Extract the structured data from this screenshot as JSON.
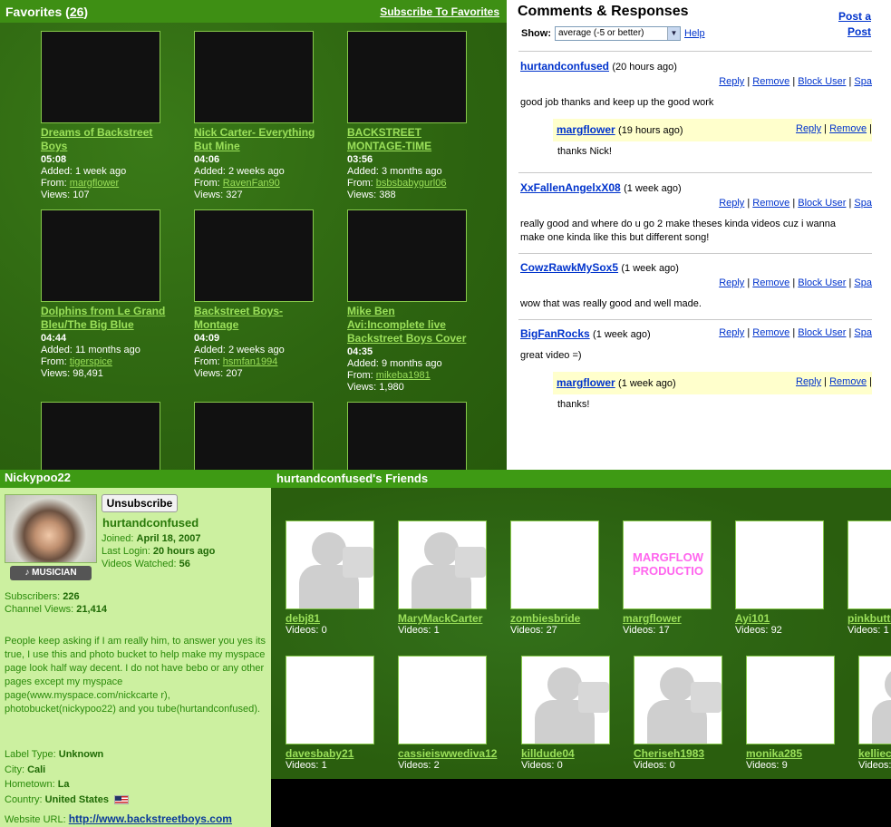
{
  "favorites": {
    "title": "Favorites",
    "count": "26",
    "subscribe_link": "Subscribe To Favorites",
    "added_label": "Added:",
    "from_label": "From:",
    "views_label": "Views:",
    "videos": [
      {
        "title": "Dreams of Backstreet Boys",
        "duration": "05:08",
        "added": "1 week ago",
        "from": "margflower",
        "views": "107"
      },
      {
        "title": "Nick Carter- Everything But Mine",
        "duration": "04:06",
        "added": "2 weeks ago",
        "from": "RavenFan90",
        "views": "327"
      },
      {
        "title": "BACKSTREET MONTAGE-TIME",
        "duration": "03:56",
        "added": "3 months ago",
        "from": "bsbsbabygurl06",
        "views": "388"
      },
      {
        "title": "Dolphins from Le Grand Bleu/The Big Blue",
        "duration": "04:44",
        "added": "11 months ago",
        "from": "tigerspice",
        "views": "98,491"
      },
      {
        "title": "Backstreet Boys-Montage",
        "duration": "04:09",
        "added": "2 weeks ago",
        "from": "hsmfan1994",
        "views": "207"
      },
      {
        "title": "Mike Ben Avi:Incomplete live Backstreet Boys Cover",
        "duration": "04:35",
        "added": "9 months ago",
        "from": "mikeba1981",
        "views": "1,980"
      }
    ]
  },
  "comments": {
    "title": "Comments & Responses",
    "post_link_line1": "Post a",
    "post_link_line2": "Post",
    "show_label": "Show:",
    "filter_value": "average (-5 or better)",
    "help_link": "Help",
    "actions": {
      "reply": "Reply",
      "remove": "Remove",
      "block": "Block User",
      "spam": "Spa"
    },
    "items": [
      {
        "user": "hurtandconfused",
        "time": "(20 hours ago)",
        "text": "good job thanks and keep up the good work",
        "reply": {
          "user": "margflower",
          "time": "(19 hours ago)",
          "text": "thanks Nick!"
        }
      },
      {
        "user": "XxFallenAngelxX08",
        "time": "(1 week ago)",
        "text": "really good and where do u go 2 make theses kinda videos cuz i wanna make one kinda like this but different song!"
      },
      {
        "user": "CowzRawkMySox5",
        "time": "(1 week ago)",
        "text": "wow that was really good and well made."
      },
      {
        "user": "BigFanRocks",
        "time": "(1 week ago)",
        "text": "great video =)",
        "reply": {
          "user": "margflower",
          "time": "(1 week ago)",
          "text": "thanks!"
        }
      }
    ]
  },
  "profile": {
    "header": "Nickypoo22",
    "badge": "MUSICIAN",
    "unsubscribe": "Unsubscribe",
    "username": "hurtandconfused",
    "joined_label": "Joined:",
    "joined": "April 18, 2007",
    "last_login_label": "Last Login:",
    "last_login": "20 hours ago",
    "videos_watched_label": "Videos Watched:",
    "videos_watched": "56",
    "subscribers_label": "Subscribers:",
    "subscribers": "226",
    "channel_views_label": "Channel Views:",
    "channel_views": "21,414",
    "bio": "People keep asking if I am really him, to answer you yes its true, I use this and photo bucket to help make my myspace page look half way decent. I do not have bebo or any other pages except my myspace page(www.myspace.com/nickcarte r), photobucket(nickypoo22) and you tube(hurtandconfused).",
    "label_type_label": "Label Type:",
    "label_type": "Unknown",
    "city_label": "City:",
    "city": "Cali",
    "hometown_label": "Hometown:",
    "hometown": "La",
    "country_label": "Country:",
    "country": "United States",
    "website_label": "Website URL:",
    "website": "http://www.backstreetboys.com"
  },
  "friends": {
    "title": "hurtandconfused's Friends",
    "videos_label": "Videos:",
    "items": [
      {
        "name": "debj81",
        "videos": "0"
      },
      {
        "name": "MaryMackCarter",
        "videos": "1"
      },
      {
        "name": "zombiesbride",
        "videos": "27"
      },
      {
        "name": "margflower",
        "videos": "17",
        "thumb_text": "MARGFLOW PRODUCTIO"
      },
      {
        "name": "Ayi101",
        "videos": "92"
      },
      {
        "name": "pinkbutte",
        "videos": "1"
      },
      {
        "name": "davesbaby21",
        "videos": "1"
      },
      {
        "name": "cassieiswwediva12",
        "videos": "2"
      },
      {
        "name": "killdude04",
        "videos": "0"
      },
      {
        "name": "Cheriseh1983",
        "videos": "0"
      },
      {
        "name": "monika285",
        "videos": "9"
      },
      {
        "name": "kelliec",
        "videos": ""
      }
    ]
  }
}
